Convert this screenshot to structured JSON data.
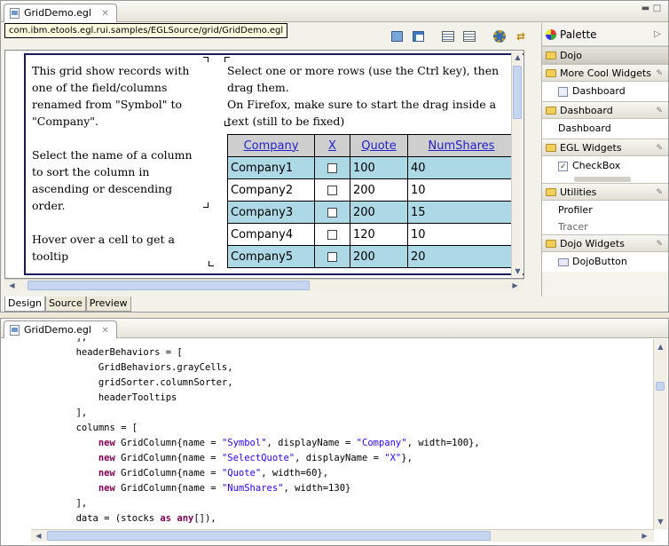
{
  "top_editor": {
    "tab_title": "GridDemo.egl",
    "tooltip_path": "com.ibm.etools.egl.rui.samples/EGLSource/grid/GridDemo.egl"
  },
  "design": {
    "left_text": [
      "This grid show records with one of the field/columns renamed from \"Symbol\" to \"Company\".",
      "Select the name of a column to sort the column in ascending or descending order.",
      "Hover over a cell to get a tooltip"
    ],
    "right_text": [
      "Select one or more rows (use the Ctrl key), then drag them.",
      "On Firefox, make sure to start the drag inside a text (still to be fixed)"
    ],
    "grid": {
      "headers": [
        "Company",
        "X",
        "Quote",
        "NumShares"
      ],
      "rows": [
        {
          "company": "Company1",
          "quote": "100",
          "shares": "40"
        },
        {
          "company": "Company2",
          "quote": "200",
          "shares": "10"
        },
        {
          "company": "Company3",
          "quote": "200",
          "shares": "15"
        },
        {
          "company": "Company4",
          "quote": "120",
          "shares": "10"
        },
        {
          "company": "Company5",
          "quote": "200",
          "shares": "20"
        }
      ]
    }
  },
  "bottom_tabs": [
    "Design",
    "Source",
    "Preview"
  ],
  "palette": {
    "title": "Palette",
    "drawers": {
      "dojo": "Dojo",
      "more_cool": "More Cool Widgets",
      "more_cool_item": "Dashboard",
      "dashboard": "Dashboard",
      "dashboard_item": "Dashboard",
      "egl_widgets": "EGL Widgets",
      "egl_item": "CheckBox",
      "utilities": "Utilities",
      "util_item1": "Profiler",
      "util_item2": "Tracer",
      "dojo_widgets": "Dojo Widgets",
      "dojo_widgets_item": "DojoButton"
    }
  },
  "bottom_editor": {
    "tab_title": "GridDemo.egl",
    "code": [
      [
        {
          "t": "        ],",
          "c": ""
        }
      ],
      [
        {
          "t": "        headerBehaviors = [",
          "c": ""
        }
      ],
      [
        {
          "t": "            GridBehaviors.grayCells,",
          "c": ""
        }
      ],
      [
        {
          "t": "            gridSorter.columnSorter,",
          "c": ""
        }
      ],
      [
        {
          "t": "            headerTooltips",
          "c": ""
        }
      ],
      [
        {
          "t": "        ],",
          "c": ""
        }
      ],
      [
        {
          "t": "        columns = [",
          "c": ""
        }
      ],
      [
        {
          "t": "            ",
          "c": ""
        },
        {
          "t": "new",
          "c": "kw"
        },
        {
          "t": " GridColumn{name = ",
          "c": ""
        },
        {
          "t": "\"Symbol\"",
          "c": "str"
        },
        {
          "t": ", displayName = ",
          "c": ""
        },
        {
          "t": "\"Company\"",
          "c": "str"
        },
        {
          "t": ", width=100},",
          "c": ""
        }
      ],
      [
        {
          "t": "            ",
          "c": ""
        },
        {
          "t": "new",
          "c": "kw"
        },
        {
          "t": " GridColumn{name = ",
          "c": ""
        },
        {
          "t": "\"SelectQuote\"",
          "c": "str"
        },
        {
          "t": ", displayName = ",
          "c": ""
        },
        {
          "t": "\"X\"",
          "c": "str"
        },
        {
          "t": "},",
          "c": ""
        }
      ],
      [
        {
          "t": "            ",
          "c": ""
        },
        {
          "t": "new",
          "c": "kw"
        },
        {
          "t": " GridColumn{name = ",
          "c": ""
        },
        {
          "t": "\"Quote\"",
          "c": "str"
        },
        {
          "t": ", width=60},",
          "c": ""
        }
      ],
      [
        {
          "t": "            ",
          "c": ""
        },
        {
          "t": "new",
          "c": "kw"
        },
        {
          "t": " GridColumn{name = ",
          "c": ""
        },
        {
          "t": "\"NumShares\"",
          "c": "str"
        },
        {
          "t": ", width=130}",
          "c": ""
        }
      ],
      [
        {
          "t": "        ],",
          "c": ""
        }
      ],
      [
        {
          "t": "        data = (stocks ",
          "c": ""
        },
        {
          "t": "as",
          "c": "kw"
        },
        {
          "t": " ",
          "c": ""
        },
        {
          "t": "any",
          "c": "kw"
        },
        {
          "t": "[]),",
          "c": ""
        }
      ]
    ]
  }
}
